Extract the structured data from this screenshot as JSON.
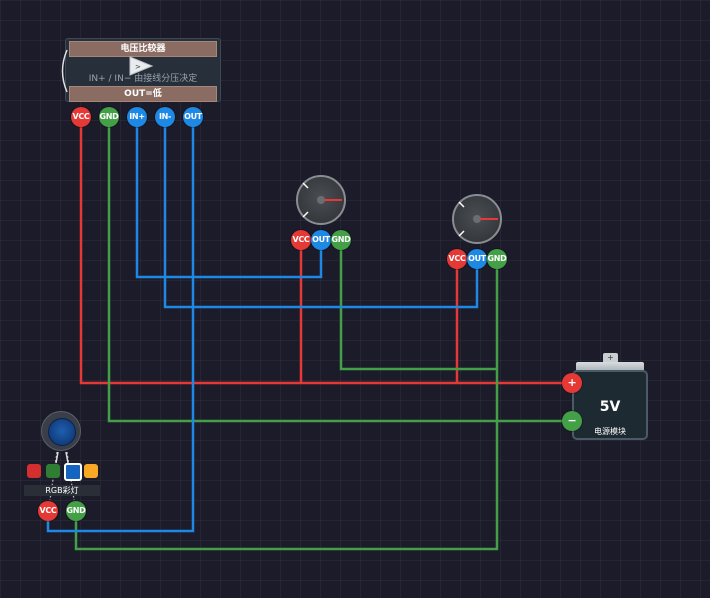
{
  "comparator": {
    "title": "电压比较器",
    "subtitle": "IN+ / IN− 由接线分压决定",
    "output_label": "OUT=低",
    "pins": [
      "VCC",
      "GND",
      "IN+",
      "IN-",
      "OUT"
    ]
  },
  "potentiometer_1": {
    "pins": [
      "VCC",
      "OUT",
      "GND"
    ]
  },
  "potentiometer_2": {
    "pins": [
      "VCC",
      "OUT",
      "GND"
    ]
  },
  "power_supply": {
    "voltage": "5V",
    "label": "电源模块",
    "plus": "+",
    "minus": "−",
    "tab": "+"
  },
  "rgb_led": {
    "label": "RGB彩灯",
    "pins": [
      "VCC",
      "GND"
    ],
    "swatches": [
      "#d32f2f",
      "#2e7d32",
      "#1565c0",
      "#f9a825"
    ],
    "selected_swatch": "blue"
  },
  "wire_colors": {
    "power": "#e53935",
    "ground": "#43a047",
    "signal": "#1e88e5"
  }
}
